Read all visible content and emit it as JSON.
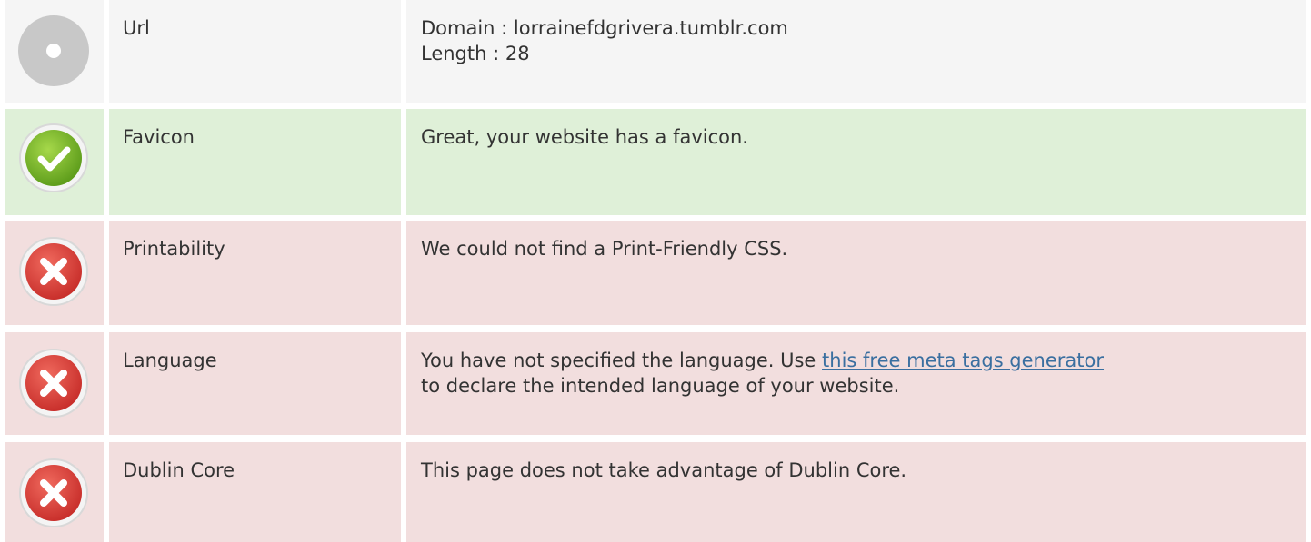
{
  "rows": [
    {
      "status": "neutral",
      "icon": "neutral-circle-icon",
      "label": "Url",
      "lines": [
        "Domain : lorrainefdgrivera.tumblr.com",
        "Length : 28"
      ]
    },
    {
      "status": "pass",
      "icon": "check-circle-icon",
      "label": "Favicon",
      "text": "Great, your website has a favicon."
    },
    {
      "status": "fail",
      "icon": "error-circle-icon",
      "label": "Printability",
      "text": "We could not find a Print-Friendly CSS."
    },
    {
      "status": "fail",
      "icon": "error-circle-icon",
      "label": "Language",
      "text_before": "You have not specified the language. Use ",
      "link_text": "this free meta tags generator",
      "text_after": " to declare the intended language of your website."
    },
    {
      "status": "fail",
      "icon": "error-circle-icon",
      "label": "Dublin Core",
      "text": "This page does not take advantage of Dublin Core."
    }
  ],
  "colors": {
    "neutral_bg": "#f5f5f5",
    "pass_bg": "#dff0d8",
    "fail_bg": "#f2dede",
    "link": "#3a6fa0",
    "check_green": "#7ab82c",
    "error_red": "#e03c3c",
    "neutral_gray": "#c8c8c8"
  }
}
